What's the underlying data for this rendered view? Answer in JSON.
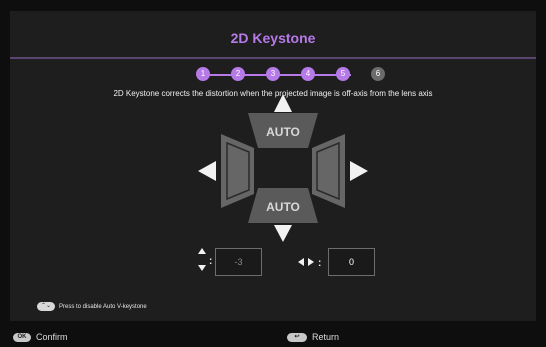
{
  "header": {
    "title": "2D Keystone"
  },
  "steps": [
    {
      "label": "1",
      "state": "done"
    },
    {
      "label": "2",
      "state": "done"
    },
    {
      "label": "3",
      "state": "done"
    },
    {
      "label": "4",
      "state": "done"
    },
    {
      "label": "5",
      "state": "done"
    },
    {
      "label": "6",
      "state": "inactive"
    }
  ],
  "description": "2D Keystone corrects the distortion when the projected image is off-axis from the lens axis",
  "controls": {
    "top_auto": "AUTO",
    "bottom_auto": "AUTO",
    "vertical_value": "-3",
    "horizontal_value": "0",
    "separator": ":"
  },
  "hint": {
    "text": "Press to disable Auto V-keystone"
  },
  "footer": {
    "confirm_key": "OK",
    "confirm_label": "Confirm",
    "return_label": "Return"
  },
  "colors": {
    "accent": "#b679e8",
    "panel": "#1e1e1e",
    "background": "#0e0e0e"
  }
}
